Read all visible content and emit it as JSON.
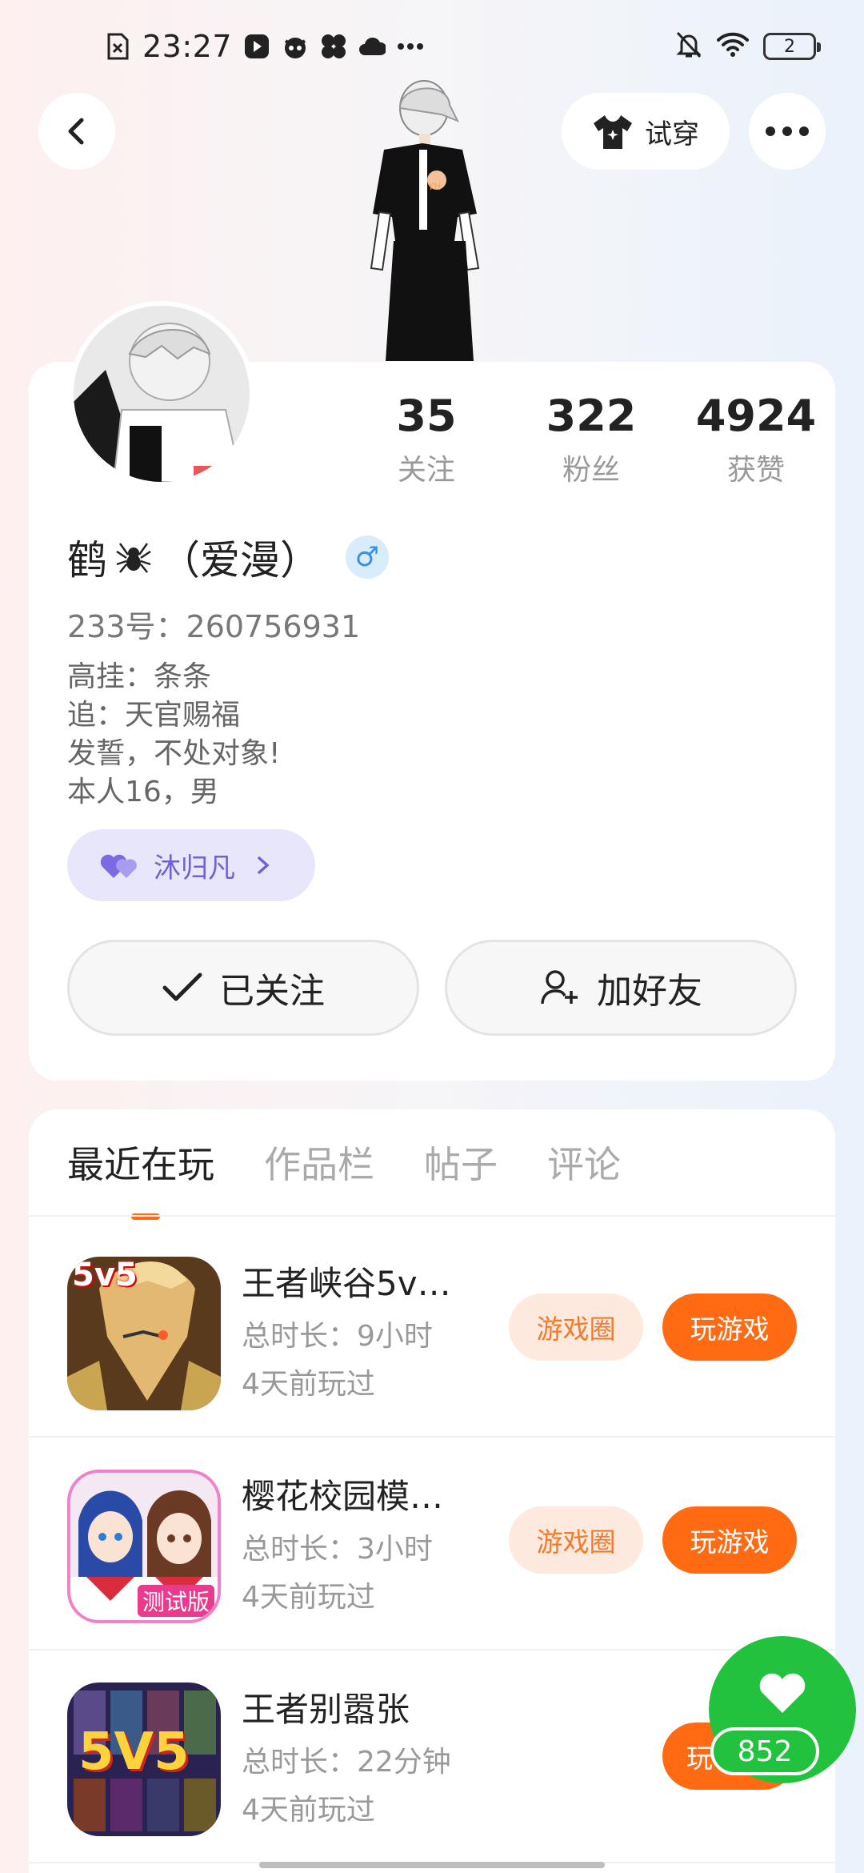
{
  "status_bar": {
    "time": "23:27",
    "battery": "2"
  },
  "header": {
    "tryon_label": "试穿"
  },
  "profile": {
    "stats": [
      {
        "value": "35",
        "label": "关注"
      },
      {
        "value": "322",
        "label": "粉丝"
      },
      {
        "value": "4924",
        "label": "获赞"
      }
    ],
    "nickname_part1": "鹤",
    "nickname_part2": "（爱漫）",
    "gender_symbol": "♂",
    "id_line": "233号：260756931",
    "bio_lines": [
      "高挂：条条",
      "追：天官赐福",
      "发誓，不处对象!",
      "本人16，男"
    ],
    "fan_tag": "沐归凡",
    "follow_label": "已关注",
    "add_friend_label": "加好友"
  },
  "tabs": [
    {
      "label": "最近在玩",
      "active": true
    },
    {
      "label": "作品栏",
      "active": false
    },
    {
      "label": "帖子",
      "active": false
    },
    {
      "label": "评论",
      "active": false
    }
  ],
  "games": [
    {
      "name": "王者峡谷5v…",
      "duration": "总时长：9小时",
      "last_played": "4天前玩过",
      "circle_label": "游戏圈",
      "play_label": "玩游戏",
      "icon_text": "5v5"
    },
    {
      "name": "樱花校园模…",
      "duration": "总时长：3小时",
      "last_played": "4天前玩过",
      "circle_label": "游戏圈",
      "play_label": "玩游戏",
      "icon_text": "测试版"
    },
    {
      "name": "王者别嚣张",
      "duration": "总时长：22分钟",
      "last_played": "4天前玩过",
      "play_label": "玩",
      "icon_text": "5V5"
    }
  ],
  "like": {
    "count": "852"
  },
  "colors": {
    "accent": "#ff6a13",
    "like_green": "#22c23e",
    "fan_purple": "#6f62d6"
  }
}
